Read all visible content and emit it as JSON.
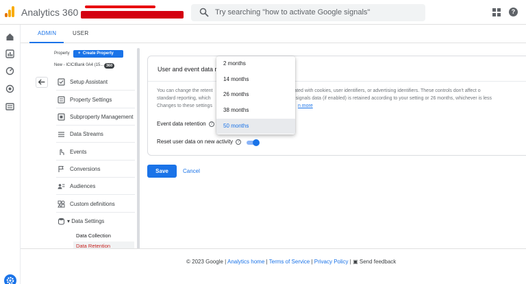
{
  "topbar": {
    "app_title": "Analytics 360",
    "search_placeholder": "Try searching \"how to activate Google signals\""
  },
  "tabs": {
    "admin": "ADMIN",
    "user": "USER"
  },
  "property": {
    "label": "Property",
    "create_button": "Create Property",
    "name": "New - ICICIBank 0A4 (15...",
    "badge": "360"
  },
  "menu": [
    {
      "label": "Setup Assistant",
      "icon": "checkbox-icon"
    },
    {
      "label": "Property Settings",
      "icon": "settings-panel-icon"
    },
    {
      "label": "Subproperty Management",
      "icon": "subproperty-icon"
    },
    {
      "label": "Data Streams",
      "icon": "data-streams-icon"
    },
    {
      "label": "Events",
      "icon": "touch-icon"
    },
    {
      "label": "Conversions",
      "icon": "flag-icon"
    },
    {
      "label": "Audiences",
      "icon": "audiences-icon"
    },
    {
      "label": "Custom definitions",
      "icon": "custom-definitions-icon"
    },
    {
      "label": "Data Settings",
      "icon": "database-icon"
    }
  ],
  "submenu": [
    "Data Collection",
    "Data Retention"
  ],
  "card": {
    "title": "User and event data re",
    "desc_line1": "You can change the retent",
    "desc_line1_b": "is associated with cookies, user identifiers, or advertising identifiers. These controls don't affect o",
    "desc_line2": "standard reporting, which",
    "desc_line2_b": "oogle signals data (if enabled) is retained according to your setting or 26 months, whichever is less",
    "desc_line3": "Changes to these settings",
    "desc_link": "n more",
    "event_retention_label": "Event data retention",
    "reset_label": "Reset user data on new activity",
    "reset_enabled": true
  },
  "dropdown": {
    "options": [
      "2 months",
      "14 months",
      "26 months",
      "38 months",
      "50 months"
    ],
    "selected": "50 months"
  },
  "actions": {
    "save": "Save",
    "cancel": "Cancel"
  },
  "footer": {
    "copyright": "© 2023 Google | ",
    "analytics_home": "Analytics home",
    "sep1": " | ",
    "terms": "Terms of Service",
    "sep2": " | ",
    "privacy": "Privacy Policy",
    "sep3": " | ",
    "feedback": "Send feedback"
  },
  "colors": {
    "accent": "#1a73e8",
    "selected_red": "#c5221f",
    "logo_orange": "#f9ab00",
    "logo_dark": "#e37400"
  }
}
